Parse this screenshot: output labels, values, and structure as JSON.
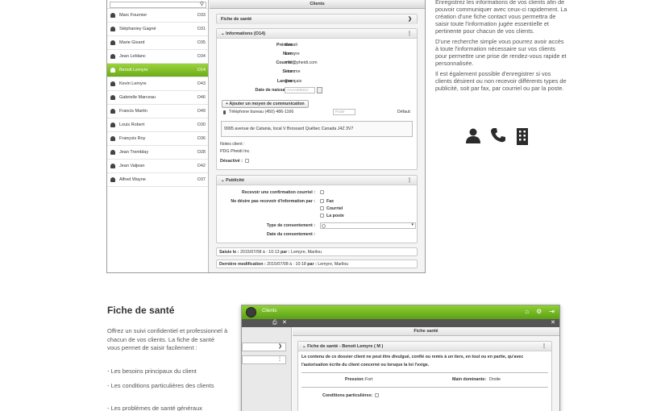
{
  "clients": [
    {
      "name": "Marc Fournier",
      "code": "O33"
    },
    {
      "name": "Stéphaniey Gagné",
      "code": "O31"
    },
    {
      "name": "Marie Givard",
      "code": "O35"
    },
    {
      "name": "Jean Leblanc",
      "code": "O34"
    },
    {
      "name": "Benoit Lemyre",
      "code": "O14",
      "selected": true
    },
    {
      "name": "Kevin Lemyre",
      "code": "O43"
    },
    {
      "name": "Gabrielle Marceau",
      "code": "O46"
    },
    {
      "name": "Francis Martin",
      "code": "O49"
    },
    {
      "name": "Louis Robert",
      "code": "O30"
    },
    {
      "name": "François Roy",
      "code": "O36"
    },
    {
      "name": "Jean Tremblay",
      "code": "O28"
    },
    {
      "name": "Jean Valjean",
      "code": "O42"
    },
    {
      "name": "Alfred Wayne",
      "code": "O37"
    }
  ],
  "app1": {
    "title": "Clients",
    "fiche_sante": "Fiche de santé",
    "fiche_chevron": "❯",
    "info_header": "Informations (O14)",
    "kebab": "⋮",
    "collapse": "⌄",
    "prenom_label": "Prénom :",
    "prenom_value": "Benoit",
    "nom_label": "Nom :",
    "nom_value": "Lemyre",
    "courriel_label": "Courriel :",
    "courriel_value": "info@pheidi.com",
    "sexe_label": "Sexe :",
    "sexe_value": "Homme",
    "langue_label": "Langue :",
    "langue_value": "Français",
    "naissance_label": "Date de naissance :",
    "naissance_placeholder": "AAAA/MM/JJ",
    "add_comm": "Ajouter un moyen de communication",
    "add_plus": "+",
    "phone_label": "Téléphone bureau (450) 486-1166",
    "poste_placeholder": "Poste",
    "defaut": "Défaut:",
    "address": "9995 avenue de Catania, local V   Brossard   Québec   Canada   J4Z 3V7",
    "notes_label": "Notes client :",
    "notes_value": "PDG Pheidi Inc.",
    "desactive_label": "Désactivé :",
    "pub_header": "Publicité",
    "confirm_label": "Recevoir une confirmation courriel :",
    "nepas_label": "Ne désire pas recevoir d'information par :",
    "opt_fax": "Fax",
    "opt_courriel": "Courriel",
    "opt_poste": "La poste",
    "type_label": "Type de consentement :",
    "date_consent_label": "Date du consentement :",
    "saisie_label": "Saisie le :",
    "saisie_value": "2015/07/08 à : 10:13",
    "saisie_par_label": "par :",
    "saisie_par_value": "Lemyre, Marilou",
    "modif_label": "Dernière modification :",
    "modif_value": "2015/07/08 à : 10:18",
    "modif_par_label": "par :",
    "modif_par_value": "Lemyre, Marilou"
  },
  "prose": {
    "p1": "Enregistrez les informations de vos clients afin de pouvoir communiquer avec ceux-ci rapidement. La création d'une fiche contact vous permettra de saisir toute l'information jugée essentielle et pertinente pour chacun de vos clients.",
    "p2": "D'une recherche simple vous pourrez avoir accès à toute l'information nécessaire sur vos clients pour permettre une prise de rendez-vous rapide et personnalisée.",
    "p3": "Il est également possible d'enregistrer si vos clients désirent ou non recevoir différents types de publicité, soit par fax, par courriel ou par la poste."
  },
  "bottom": {
    "title": "Fiche de santé",
    "intro": "Offrez un suivi confidentiel et professionnel à chacun de vos clients. La fiche de santé vous permet de saisir facilement :",
    "item1": "- Les besoins principaux du client",
    "item2": "- Les conditions particulières des clients",
    "item3": "- Les problèmes de santé généraux"
  },
  "app2": {
    "app_title": "Clients",
    "home_icon": "⌂",
    "gear_icon": "⚙",
    "exit_icon": "⇥",
    "print_icon": "⎙",
    "close_icon": "✕",
    "left_btn1": "❯",
    "left_btn2": "⋮",
    "chrome_title": "Fiche santé",
    "fiche_header": "Fiche de santé - Benoit Lemyre ( M )",
    "conf_text": "Le contenu de ce dossier client ne peut être divulgué, confié ou remis à un tiers, en tout ou en partie, qu'avec l'autorisation écrite du client concerné ou lorsque la loi l'exige.",
    "pression_label": "Pression:",
    "pression_value": "Fort",
    "main_label": "Main dominante:",
    "main_value": "Droite",
    "cond_label": "Conditions particulières:"
  }
}
